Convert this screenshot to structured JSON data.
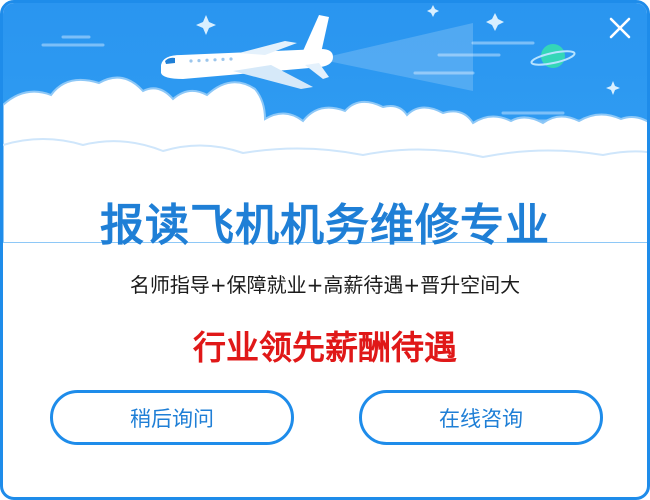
{
  "dialog": {
    "title": "报读飞机机务维修专业",
    "subtitle": "名师指导+保障就业+高薪待遇+晋升空间大",
    "highlight": "行业领先薪酬待遇",
    "buttons": {
      "ask_later": "稍后询问",
      "consult_online": "在线咨询"
    },
    "close_icon": "close-icon"
  },
  "colors": {
    "accent_blue": "#1e8cea",
    "title_blue": "#1f7fd6",
    "highlight_red": "#e01818",
    "sky_blue": "#2f9cf2"
  }
}
